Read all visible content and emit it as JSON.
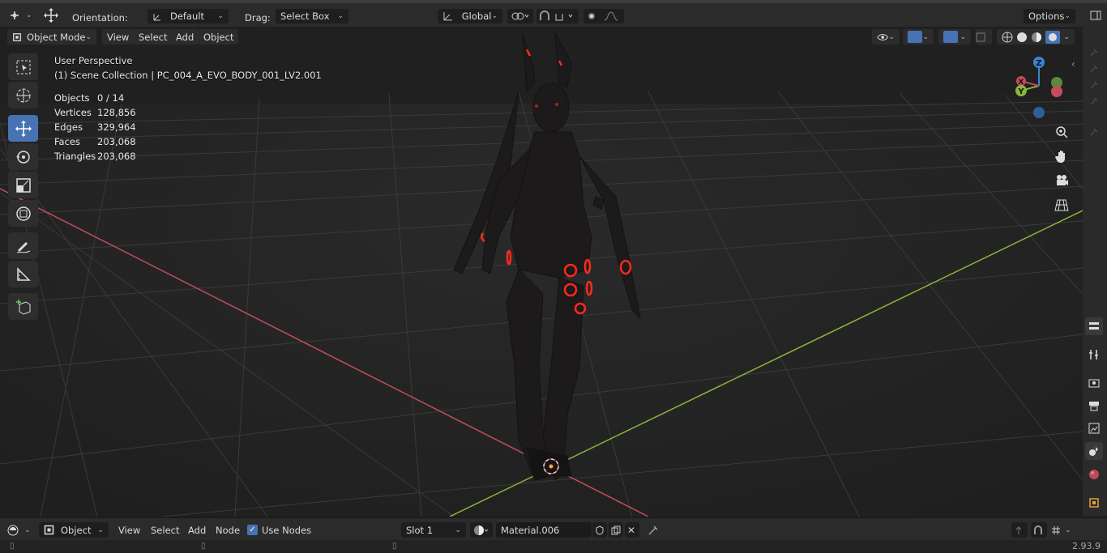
{
  "top": {
    "orientation_label": "Orientation:",
    "orientation_value": "Default",
    "drag_label": "Drag:",
    "drag_value": "Select Box",
    "transform_space": "Global",
    "options_label": "Options"
  },
  "viewport_header": {
    "mode": "Object Mode",
    "menus": [
      "View",
      "Select",
      "Add",
      "Object"
    ]
  },
  "overlay": {
    "view_name": "User Perspective",
    "collection": "(1) Scene Collection | PC_004_A_EVO_BODY_001_LV2.001",
    "stats": [
      {
        "label": "Objects",
        "value": "0 / 14"
      },
      {
        "label": "Vertices",
        "value": "128,856"
      },
      {
        "label": "Edges",
        "value": "329,964"
      },
      {
        "label": "Faces",
        "value": "203,068"
      },
      {
        "label": "Triangles",
        "value": "203,068"
      }
    ]
  },
  "gizmo": {
    "z": "Z",
    "y": "Y",
    "x": "X"
  },
  "bottom": {
    "editor_type": "Object",
    "menus": [
      "View",
      "Select",
      "Add",
      "Node"
    ],
    "use_nodes_label": "Use Nodes",
    "use_nodes_checked": true,
    "slot": "Slot 1",
    "material": "Material.006"
  },
  "status": {
    "version": "2.93.9"
  },
  "colors": {
    "accent": "#4772b3",
    "x_axis": "#c44d5c",
    "y_axis": "#8bb53b",
    "z_axis": "#3b84d6",
    "highlight_red": "#ff2a1a"
  }
}
